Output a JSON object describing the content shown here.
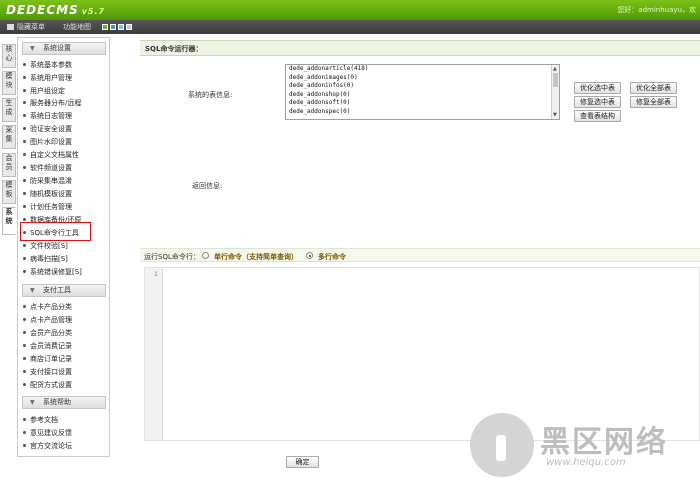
{
  "header": {
    "logo": "DEDECMS",
    "version": "v5.7",
    "user_info": "您好：adminhuayu，欢"
  },
  "topbar": {
    "hide_menu": "隐藏菜单",
    "sitemap": "功能地图",
    "skin_colors": [
      "#6ab520",
      "#4a90d9",
      "#8fb8e6",
      "#c9c9c9"
    ]
  },
  "vtabs": [
    "核心",
    "模块",
    "生成",
    "采集",
    "会员",
    "模板",
    "系统"
  ],
  "menu": {
    "sections": [
      {
        "title": "系统设置",
        "items": [
          "系统基本参数",
          "系统用户管理",
          "用户组设定",
          "服务器分布/远程",
          "系统日志管理",
          "验证安全设置",
          "图片水印设置",
          "自定义文档属性",
          "软件频道设置",
          "防采集串混淆",
          "随机模板设置",
          "计划任务管理",
          "数据库备份/还原",
          "SQL命令行工具",
          "文件校验[S]",
          "病毒扫描[S]",
          "系统错误修复[S]"
        ]
      },
      {
        "title": "支付工具",
        "items": [
          "点卡产品分类",
          "点卡产品管理",
          "会员产品分类",
          "会员消费记录",
          "商店订单记录",
          "支付接口设置",
          "配货方式设置"
        ]
      },
      {
        "title": "系统帮助",
        "items": [
          "参考文档",
          "意见建议反馈",
          "官方交流论坛"
        ]
      }
    ]
  },
  "main": {
    "title": "SQL命令运行器：",
    "tables_label": "系统的表信息:",
    "tables": [
      "dede_addonarticle(418)",
      "dede_addonimages(0)",
      "dede_addoninfos(0)",
      "dede_addonshop(0)",
      "dede_addonsoft(0)",
      "dede_addonspec(0)"
    ],
    "buttons": {
      "optimize_selected": "优化选中表",
      "optimize_all": "优化全部表",
      "repair_selected": "修复选中表",
      "repair_all": "修复全部表",
      "view_structure": "查看表结构"
    },
    "result_label": "返回信息:",
    "cmd_label": "运行SQL命令行：",
    "single_cmd": "单行命令（支持简单查询）",
    "multi_cmd": "多行命令",
    "line_number": "1",
    "ok": "确定"
  },
  "watermark": {
    "title": "黑区网络",
    "url": "www.heiqu.com"
  }
}
